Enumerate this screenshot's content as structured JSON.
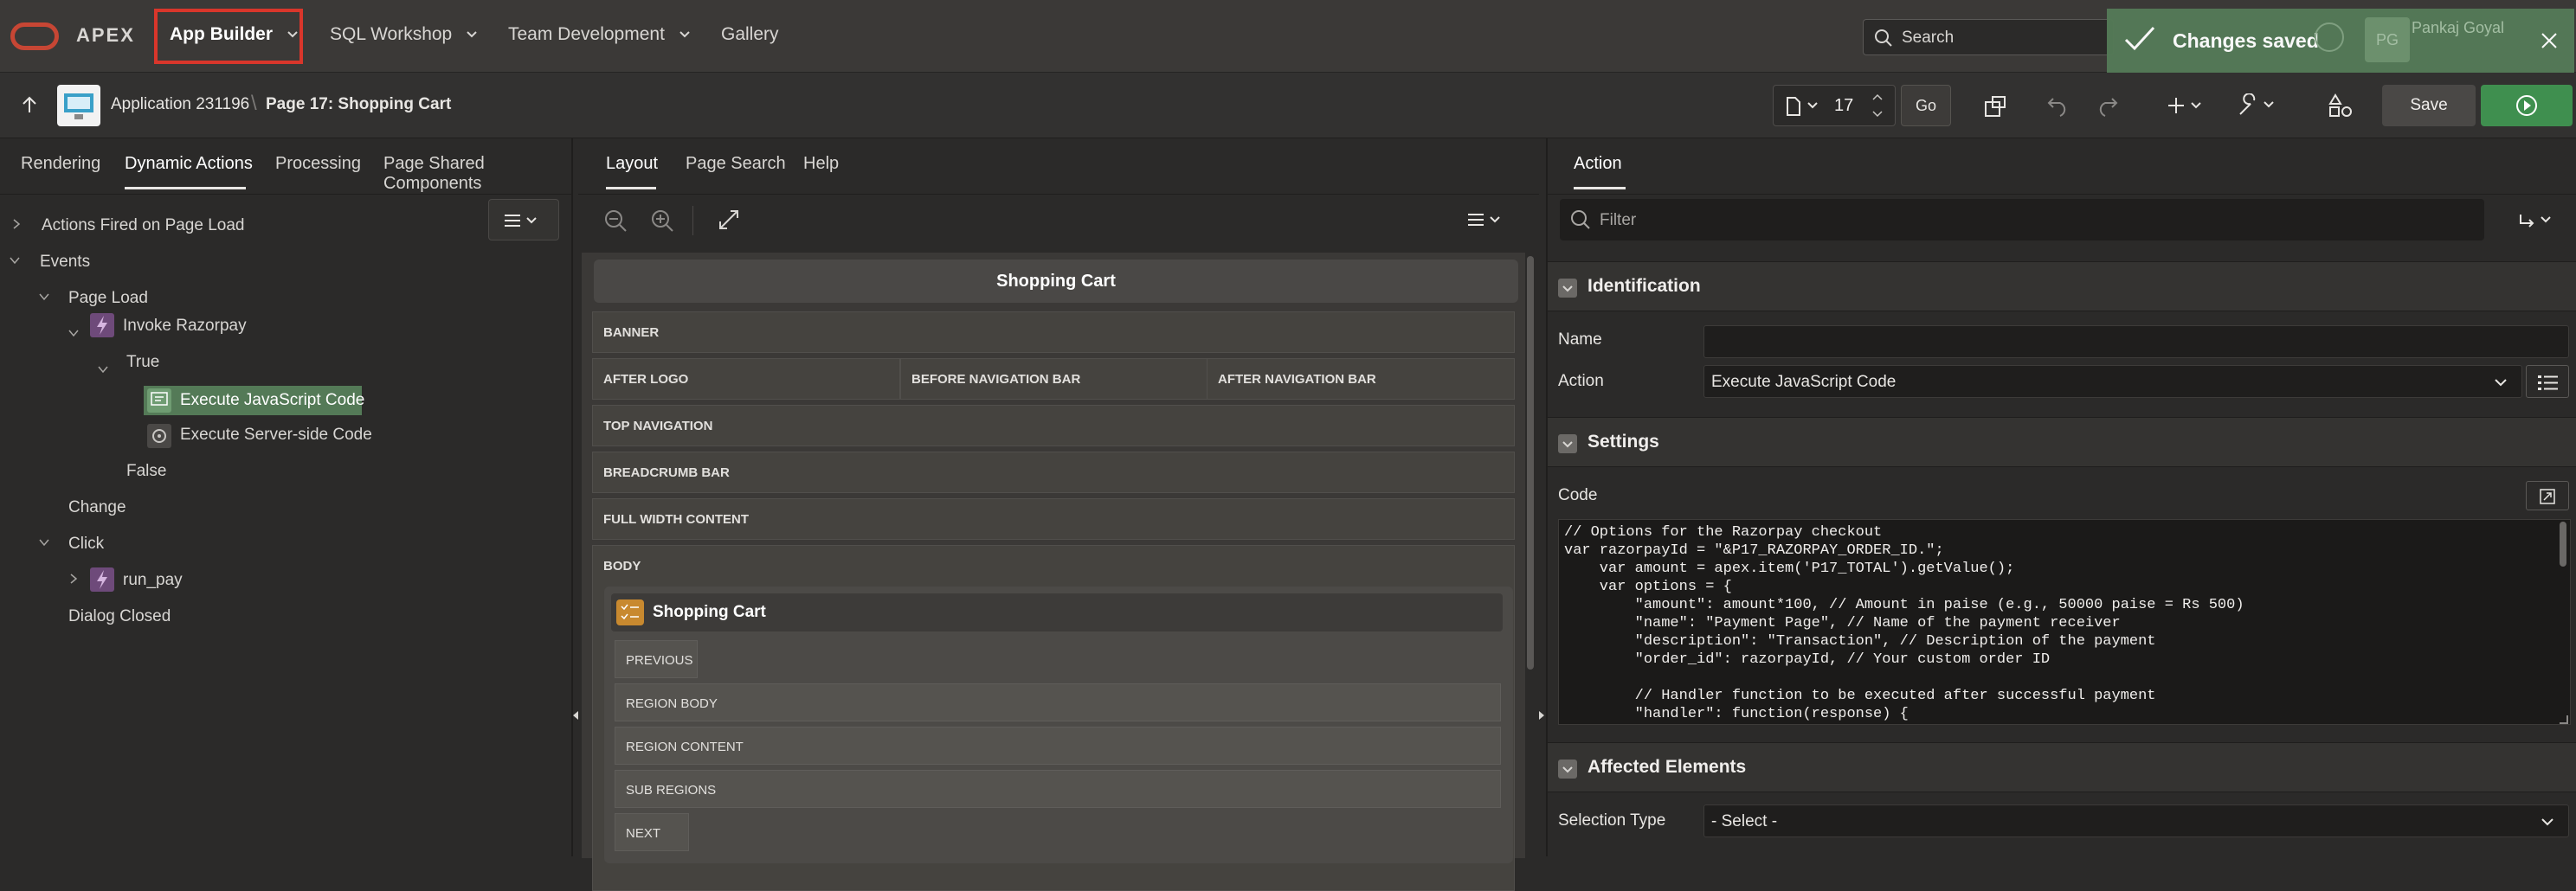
{
  "topnav": {
    "brand": "APEX",
    "items": [
      {
        "label": "App Builder"
      },
      {
        "label": "SQL Workshop"
      },
      {
        "label": "Team Development"
      },
      {
        "label": "Gallery"
      }
    ],
    "search_placeholder": "Search",
    "toast_message": "Changes saved",
    "user_initials": "PG",
    "user_name": "Pankaj Goyal"
  },
  "subbar": {
    "application": "Application 231196",
    "page": "Page 17: Shopping Cart",
    "page_number": "17",
    "go_label": "Go",
    "save_label": "Save"
  },
  "left": {
    "tabs": [
      "Rendering",
      "Dynamic Actions",
      "Processing",
      "Page Shared Components"
    ],
    "active_tab": "Dynamic Actions",
    "tree": {
      "actions_fired": "Actions Fired on Page Load",
      "events": "Events",
      "page_load": "Page Load",
      "invoke_razorpay": "Invoke Razorpay",
      "true_label": "True",
      "execute_js": "Execute JavaScript Code",
      "execute_server": "Execute Server-side Code",
      "false_label": "False",
      "change": "Change",
      "click": "Click",
      "run_pay": "run_pay",
      "dialog_closed": "Dialog Closed"
    }
  },
  "middle": {
    "tabs": [
      "Layout",
      "Page Search",
      "Help"
    ],
    "active_tab": "Layout",
    "page_title": "Shopping Cart",
    "slots": {
      "banner": "BANNER",
      "after_logo": "AFTER LOGO",
      "before_nav": "BEFORE NAVIGATION BAR",
      "after_nav": "AFTER NAVIGATION BAR",
      "top_nav": "TOP NAVIGATION",
      "breadcrumb": "BREADCRUMB BAR",
      "full_width": "FULL WIDTH CONTENT",
      "body": "BODY"
    },
    "region": {
      "title": "Shopping Cart",
      "previous": "PREVIOUS",
      "region_body": "REGION BODY",
      "region_content": "REGION CONTENT",
      "sub_regions": "SUB REGIONS",
      "next": "NEXT"
    }
  },
  "right": {
    "tab": "Action",
    "filter_placeholder": "Filter",
    "identification": {
      "title": "Identification",
      "name_label": "Name",
      "name_value": "",
      "action_label": "Action",
      "action_value": "Execute JavaScript Code"
    },
    "settings": {
      "title": "Settings",
      "code_label": "Code",
      "code_lines": [
        "// Options for the Razorpay checkout",
        "var razorpayId = \"&P17_RAZORPAY_ORDER_ID.\";",
        "    var amount = apex.item('P17_TOTAL').getValue();",
        "    var options = {",
        "        \"amount\": amount*100, // Amount in paise (e.g., 50000 paise = Rs 500)",
        "        \"name\": \"Payment Page\", // Name of the payment receiver",
        "        \"description\": \"Transaction\", // Description of the payment",
        "        \"order_id\": razorpayId, // Your custom order ID",
        "",
        "        // Handler function to be executed after successful payment",
        "        \"handler\": function(response) {"
      ]
    },
    "affected": {
      "title": "Affected Elements",
      "selection_label": "Selection Type",
      "selection_value": "- Select -"
    }
  },
  "colors": {
    "accent_red": "#d9362b",
    "toast_green": "#547a57",
    "run_green": "#3f8f4f",
    "selected_green": "#547a57"
  }
}
